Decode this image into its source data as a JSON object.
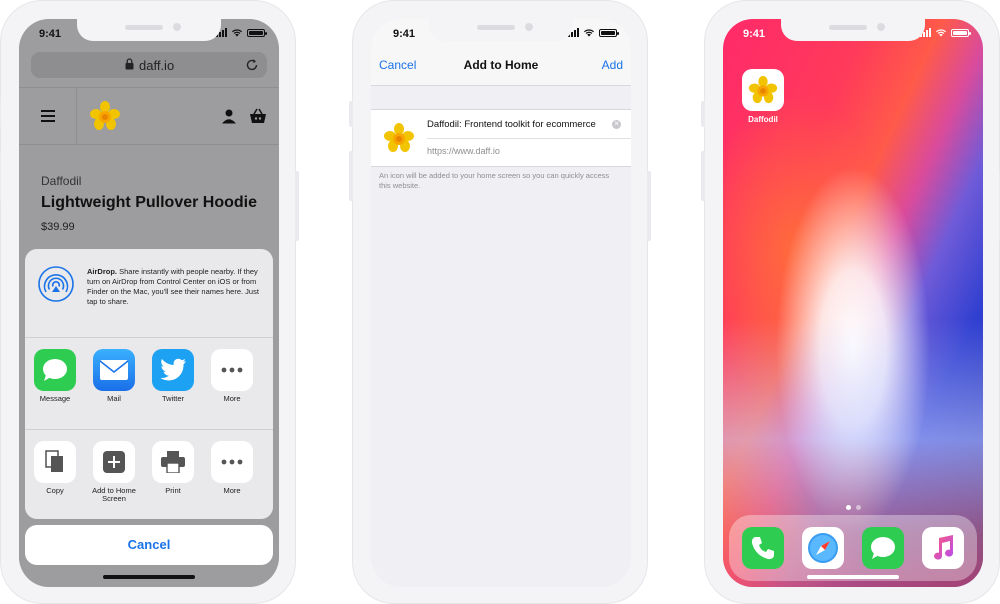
{
  "status_time": "9:41",
  "safari": {
    "url": "daff.io",
    "product": {
      "brand": "Daffodil",
      "title": "Lightweight Pullover Hoodie",
      "price": "$39.99"
    },
    "share_sheet": {
      "airdrop_title": "AirDrop.",
      "airdrop_text": "Share instantly with people nearby. If they turn on AirDrop from Control Center on iOS or from Finder on the Mac, you'll see their names here. Just tap to share.",
      "apps": [
        {
          "label": "Message",
          "icon": "messages-icon"
        },
        {
          "label": "Mail",
          "icon": "mail-icon"
        },
        {
          "label": "Twitter",
          "icon": "twitter-icon"
        },
        {
          "label": "More",
          "icon": "more-icon"
        }
      ],
      "actions": [
        {
          "label": "Copy",
          "icon": "copy-icon"
        },
        {
          "label": "Add to Home Screen",
          "icon": "add-square-icon"
        },
        {
          "label": "Print",
          "icon": "printer-icon"
        },
        {
          "label": "More",
          "icon": "more-icon"
        }
      ],
      "cancel": "Cancel"
    }
  },
  "add_to_home": {
    "cancel": "Cancel",
    "title": "Add to Home",
    "add": "Add",
    "app_name": "Daffodil: Frontend toolkit for ecommerce",
    "url": "https://www.daff.io",
    "note": "An icon will be added to your home screen so you can quickly access this website."
  },
  "home_screen": {
    "app_label": "Daffodil",
    "dock": [
      "phone-icon",
      "safari-icon",
      "messages-icon",
      "music-icon"
    ]
  },
  "colors": {
    "ios_blue": "#1a73e8",
    "green": "#2fcc52",
    "twitter": "#1da1f2"
  }
}
